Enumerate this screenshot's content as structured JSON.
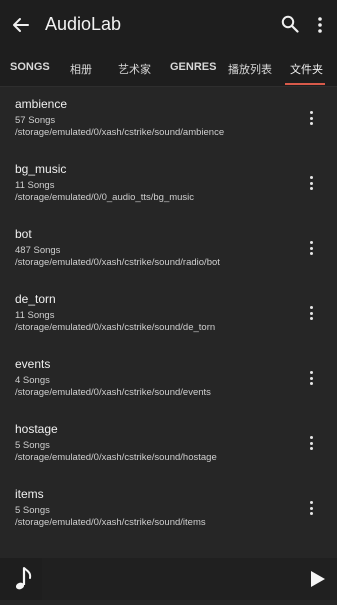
{
  "app": {
    "title": "AudioLab"
  },
  "icons": {
    "back": "arrow-left-icon",
    "search": "search-icon",
    "more": "more-vertical-icon",
    "row_menu": "more-vertical-icon",
    "album_art": "music-note-icon",
    "play": "play-icon"
  },
  "colors": {
    "accent": "#d85a4a",
    "background": "#262626",
    "appbar": "#1e1e1e"
  },
  "tabs": [
    {
      "label": "SONGS",
      "active": false
    },
    {
      "label": "相册",
      "active": false
    },
    {
      "label": "艺术家",
      "active": false
    },
    {
      "label": "GENRES",
      "active": false
    },
    {
      "label": "播放列表",
      "active": false
    },
    {
      "label": "文件夹",
      "active": true
    }
  ],
  "folders": [
    {
      "name": "ambience",
      "count": "57 Songs",
      "path": "/storage/emulated/0/xash/cstrike/sound/ambience"
    },
    {
      "name": "bg_music",
      "count": "11 Songs",
      "path": "/storage/emulated/0/0_audio_tts/bg_music"
    },
    {
      "name": "bot",
      "count": "487 Songs",
      "path": "/storage/emulated/0/xash/cstrike/sound/radio/bot"
    },
    {
      "name": "de_torn",
      "count": "11 Songs",
      "path": "/storage/emulated/0/xash/cstrike/sound/de_torn"
    },
    {
      "name": "events",
      "count": "4 Songs",
      "path": "/storage/emulated/0/xash/cstrike/sound/events"
    },
    {
      "name": "hostage",
      "count": "5 Songs",
      "path": "/storage/emulated/0/xash/cstrike/sound/hostage"
    },
    {
      "name": "items",
      "count": "5 Songs",
      "path": "/storage/emulated/0/xash/cstrike/sound/items"
    }
  ]
}
